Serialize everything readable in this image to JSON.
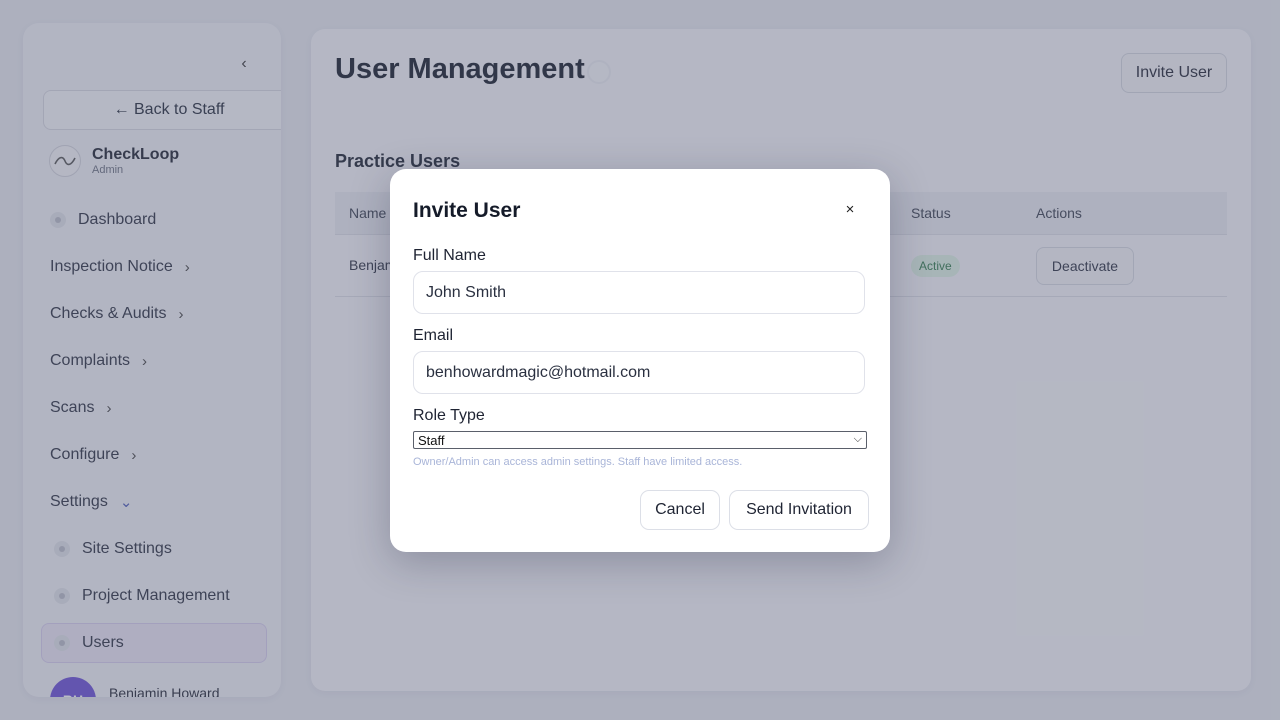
{
  "sidebar": {
    "collapse_icon": "chevron-left-icon",
    "back_label": "← Back to Staff",
    "brand": {
      "name": "CheckLoop",
      "role": "Admin",
      "logo_icon": "checkloop-logo-icon"
    },
    "items": [
      {
        "label": "Dashboard",
        "icon": "dot-icon"
      },
      {
        "label": "Inspection Notice",
        "chevron": "›"
      },
      {
        "label": "Checks & Audits",
        "chevron": "›"
      },
      {
        "label": "Complaints",
        "chevron": "›"
      },
      {
        "label": "Scans",
        "chevron": "›"
      },
      {
        "label": "Configure",
        "chevron": "›"
      },
      {
        "label": "Settings",
        "chevron": "⌄"
      }
    ],
    "sub_items": [
      {
        "label": "Site Settings"
      },
      {
        "label": "Project Management"
      },
      {
        "label": "Users",
        "active": true
      }
    ],
    "user": {
      "initials": "BH",
      "name": "Benjamin Howard"
    }
  },
  "main": {
    "title": "User Management",
    "invite_button": "Invite User",
    "section_title": "Practice Users",
    "table": {
      "columns": [
        "Name",
        "Status",
        "Actions"
      ],
      "rows": [
        {
          "name": "Benjamin Howard",
          "status": "Active",
          "action": "Deactivate"
        }
      ]
    }
  },
  "modal": {
    "title": "Invite User",
    "close": "×",
    "full_name": {
      "label": "Full Name",
      "value": "John Smith"
    },
    "email": {
      "label": "Email",
      "value": "benhowardmagic@hotmail.com"
    },
    "role": {
      "label": "Role Type",
      "selected": "Staff",
      "hint": "Owner/Admin can access admin settings. Staff have limited access."
    },
    "cancel": "Cancel",
    "send": "Send Invitation"
  },
  "colors": {
    "accent": "#6a4fd8",
    "active_badge_bg": "#dff3e6",
    "active_badge_text": "#2f7a4a",
    "hint_text": "#a9b5d8"
  }
}
